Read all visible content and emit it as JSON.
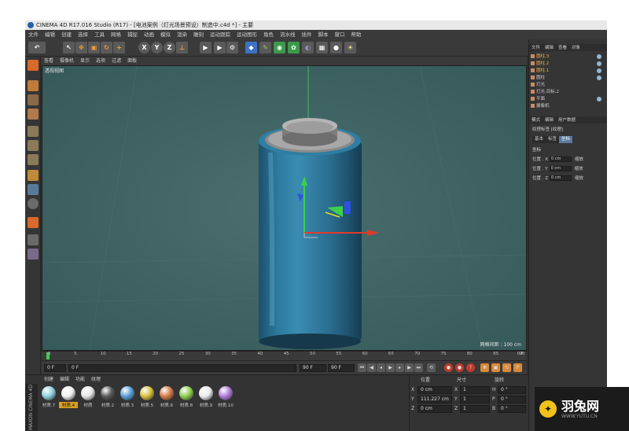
{
  "window": {
    "title": "CINEMA 4D R17.016 Studio (R17) - [电池案例（灯光场景预设）制造中.c4d *] - 主要"
  },
  "menubar": [
    "文件",
    "编辑",
    "创建",
    "选择",
    "工具",
    "网格",
    "捕捉",
    "动画",
    "模拟",
    "渲染",
    "雕刻",
    "运动跟踪",
    "运动图形",
    "角色",
    "流水线",
    "插件",
    "脚本",
    "窗口",
    "帮助"
  ],
  "viewport": {
    "menu": [
      "查看",
      "摄像机",
      "显示",
      "选项",
      "过滤",
      "面板"
    ],
    "label": "透视视图",
    "grid_label": "网格间距 : 100 cm"
  },
  "timeline": {
    "ticks": [
      "0",
      "5",
      "10",
      "15",
      "20",
      "25",
      "30",
      "35",
      "40",
      "45",
      "50",
      "55",
      "60",
      "65",
      "70",
      "75",
      "80",
      "85",
      "90"
    ],
    "end_label": "0 F",
    "start_field": "0 F",
    "current_field": "0 F",
    "end_field": "90 F",
    "end_field2": "90 F"
  },
  "materials": {
    "menu": [
      "创建",
      "编辑",
      "功能",
      "纹理"
    ],
    "items": [
      {
        "label": "材质.7",
        "color": "#8fd0dc"
      },
      {
        "label": "材质.4",
        "color": "#f0f0f0",
        "selected": true
      },
      {
        "label": "材质",
        "color": "#e6e6e6"
      },
      {
        "label": "材质.2",
        "color": "#5a5a5a"
      },
      {
        "label": "材质.3",
        "color": "#5a9fd8"
      },
      {
        "label": "材质.5",
        "color": "#d8c040"
      },
      {
        "label": "材质.6",
        "color": "#d87c48"
      },
      {
        "label": "材质.8",
        "color": "#8fd050"
      },
      {
        "label": "材质.9",
        "color": "#ececec"
      },
      {
        "label": "材质.10",
        "color": "#b07cd8"
      }
    ]
  },
  "coords": {
    "headers": [
      "位置",
      "尺寸",
      "旋转"
    ],
    "rows": [
      {
        "axis": "X",
        "pos": "0 cm",
        "size_axis": "X",
        "size": "1",
        "rot_axis": "H",
        "rot": "0 °"
      },
      {
        "axis": "Y",
        "pos": "111.227 cm",
        "size_axis": "Y",
        "size": "1",
        "rot_axis": "P",
        "rot": "0 °"
      },
      {
        "axis": "Z",
        "pos": "0 cm",
        "size_axis": "Z",
        "size": "1",
        "rot_axis": "B",
        "rot": "0 °"
      }
    ]
  },
  "objects": {
    "tabs": [
      "文件",
      "编辑",
      "查看",
      "对象"
    ],
    "items": [
      "圆柱.3",
      "圆柱.2",
      "圆柱.1",
      "圆柱",
      "灯光",
      "灯光.目标.2",
      "平面",
      "摄像机"
    ]
  },
  "attributes": {
    "tabs": [
      "模式",
      "编辑",
      "用户数据"
    ],
    "title": "纹理标签 [纹理]",
    "subtabs": [
      "基本",
      "标签",
      "坐标"
    ],
    "section": "坐标",
    "rows": [
      {
        "l": "位置 . X",
        "v": "0 cm",
        "r": "缩放"
      },
      {
        "l": "位置 . Y",
        "v": "0 cm",
        "r": "缩放"
      },
      {
        "l": "位置 . Z",
        "v": "0 cm",
        "r": "缩放"
      }
    ]
  },
  "vertical_brand": "MAXON CINEMA 4D",
  "watermark": {
    "title": "羽兔网",
    "url": "WWW.YUTU.CN"
  }
}
